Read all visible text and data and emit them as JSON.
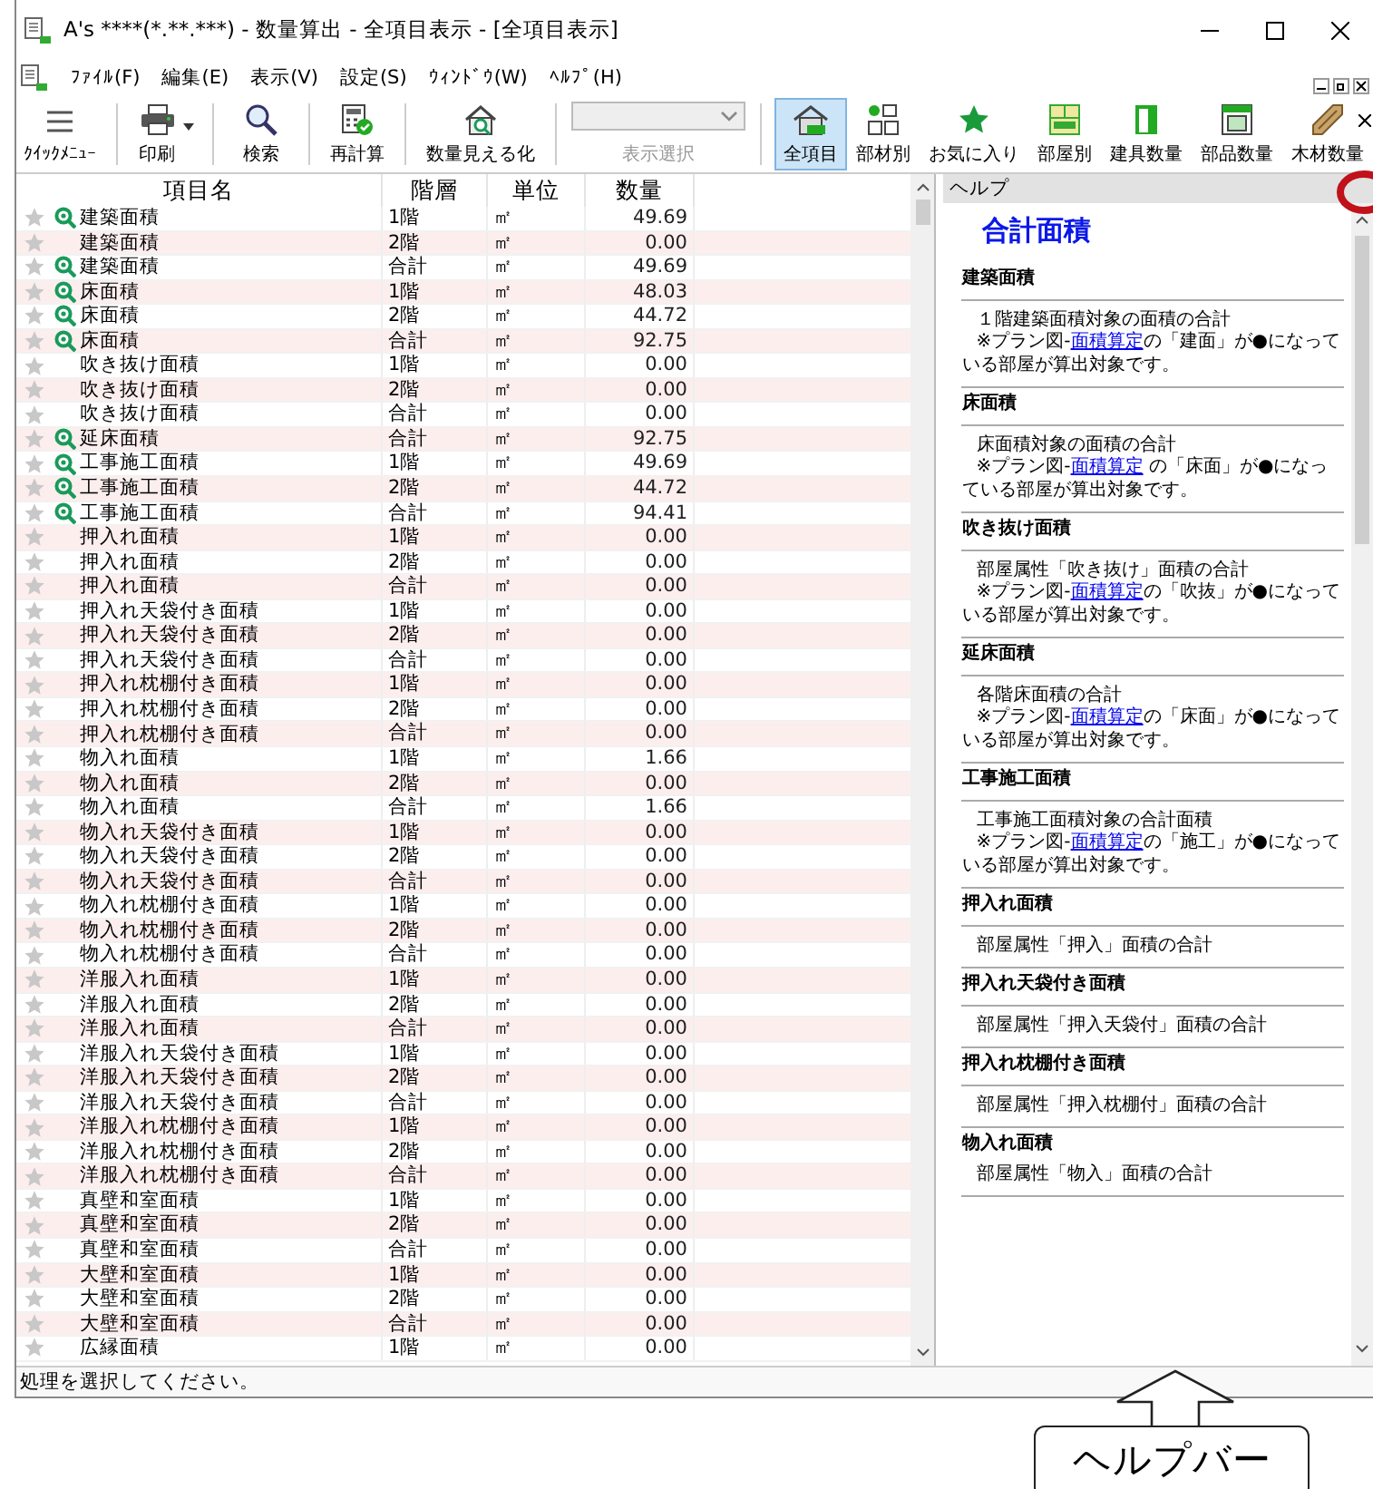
{
  "window": {
    "title": "A's ****(*.**.***) - 数量算出 - 全項目表示 - [全項目表示]"
  },
  "menu": [
    "ﾌｧｲﾙ(F)",
    "編集(E)",
    "表示(V)",
    "設定(S)",
    "ｳｨﾝﾄﾞｳ(W)",
    "ﾍﾙﾌﾟ(H)"
  ],
  "toolbar": {
    "tools": [
      {
        "label": "ｸｲｯｸﾒﾆｭｰ",
        "dropdown": false
      },
      {
        "label": "印刷",
        "dropdown": true
      },
      {
        "label": "検索",
        "dropdown": false
      },
      {
        "label": "再計算",
        "dropdown": false
      },
      {
        "label": "数量見える化",
        "dropdown": false
      }
    ],
    "view_select": {
      "label": "表示選択",
      "disabled": true
    },
    "views": [
      {
        "label": "全項目",
        "selected": true
      },
      {
        "label": "部材別",
        "selected": false
      },
      {
        "label": "お気に入り",
        "selected": false
      },
      {
        "label": "部屋別",
        "selected": false
      },
      {
        "label": "建具数量",
        "selected": false
      },
      {
        "label": "部品数量",
        "selected": false
      },
      {
        "label": "木材数量",
        "selected": false
      }
    ]
  },
  "table": {
    "columns": [
      "項目名",
      "階層",
      "単位",
      "数量"
    ],
    "rows": [
      {
        "favorite": false,
        "search": true,
        "name": "建築面積",
        "floor": "1階",
        "unit": "㎡",
        "qty": "49.69"
      },
      {
        "favorite": false,
        "search": false,
        "name": "建築面積",
        "floor": "2階",
        "unit": "㎡",
        "qty": "0.00"
      },
      {
        "favorite": false,
        "search": true,
        "name": "建築面積",
        "floor": "合計",
        "unit": "㎡",
        "qty": "49.69"
      },
      {
        "favorite": false,
        "search": true,
        "name": "床面積",
        "floor": "1階",
        "unit": "㎡",
        "qty": "48.03"
      },
      {
        "favorite": false,
        "search": true,
        "name": "床面積",
        "floor": "2階",
        "unit": "㎡",
        "qty": "44.72"
      },
      {
        "favorite": false,
        "search": true,
        "name": "床面積",
        "floor": "合計",
        "unit": "㎡",
        "qty": "92.75"
      },
      {
        "favorite": false,
        "search": false,
        "name": "吹き抜け面積",
        "floor": "1階",
        "unit": "㎡",
        "qty": "0.00"
      },
      {
        "favorite": false,
        "search": false,
        "name": "吹き抜け面積",
        "floor": "2階",
        "unit": "㎡",
        "qty": "0.00"
      },
      {
        "favorite": false,
        "search": false,
        "name": "吹き抜け面積",
        "floor": "合計",
        "unit": "㎡",
        "qty": "0.00"
      },
      {
        "favorite": false,
        "search": true,
        "name": "延床面積",
        "floor": "合計",
        "unit": "㎡",
        "qty": "92.75"
      },
      {
        "favorite": false,
        "search": true,
        "name": "工事施工面積",
        "floor": "1階",
        "unit": "㎡",
        "qty": "49.69"
      },
      {
        "favorite": false,
        "search": true,
        "name": "工事施工面積",
        "floor": "2階",
        "unit": "㎡",
        "qty": "44.72"
      },
      {
        "favorite": false,
        "search": true,
        "name": "工事施工面積",
        "floor": "合計",
        "unit": "㎡",
        "qty": "94.41"
      },
      {
        "favorite": false,
        "search": false,
        "name": "押入れ面積",
        "floor": "1階",
        "unit": "㎡",
        "qty": "0.00"
      },
      {
        "favorite": false,
        "search": false,
        "name": "押入れ面積",
        "floor": "2階",
        "unit": "㎡",
        "qty": "0.00"
      },
      {
        "favorite": false,
        "search": false,
        "name": "押入れ面積",
        "floor": "合計",
        "unit": "㎡",
        "qty": "0.00"
      },
      {
        "favorite": false,
        "search": false,
        "name": "押入れ天袋付き面積",
        "floor": "1階",
        "unit": "㎡",
        "qty": "0.00"
      },
      {
        "favorite": false,
        "search": false,
        "name": "押入れ天袋付き面積",
        "floor": "2階",
        "unit": "㎡",
        "qty": "0.00"
      },
      {
        "favorite": false,
        "search": false,
        "name": "押入れ天袋付き面積",
        "floor": "合計",
        "unit": "㎡",
        "qty": "0.00"
      },
      {
        "favorite": false,
        "search": false,
        "name": "押入れ枕棚付き面積",
        "floor": "1階",
        "unit": "㎡",
        "qty": "0.00"
      },
      {
        "favorite": false,
        "search": false,
        "name": "押入れ枕棚付き面積",
        "floor": "2階",
        "unit": "㎡",
        "qty": "0.00"
      },
      {
        "favorite": false,
        "search": false,
        "name": "押入れ枕棚付き面積",
        "floor": "合計",
        "unit": "㎡",
        "qty": "0.00"
      },
      {
        "favorite": false,
        "search": false,
        "name": "物入れ面積",
        "floor": "1階",
        "unit": "㎡",
        "qty": "1.66"
      },
      {
        "favorite": false,
        "search": false,
        "name": "物入れ面積",
        "floor": "2階",
        "unit": "㎡",
        "qty": "0.00"
      },
      {
        "favorite": false,
        "search": false,
        "name": "物入れ面積",
        "floor": "合計",
        "unit": "㎡",
        "qty": "1.66"
      },
      {
        "favorite": false,
        "search": false,
        "name": "物入れ天袋付き面積",
        "floor": "1階",
        "unit": "㎡",
        "qty": "0.00"
      },
      {
        "favorite": false,
        "search": false,
        "name": "物入れ天袋付き面積",
        "floor": "2階",
        "unit": "㎡",
        "qty": "0.00"
      },
      {
        "favorite": false,
        "search": false,
        "name": "物入れ天袋付き面積",
        "floor": "合計",
        "unit": "㎡",
        "qty": "0.00"
      },
      {
        "favorite": false,
        "search": false,
        "name": "物入れ枕棚付き面積",
        "floor": "1階",
        "unit": "㎡",
        "qty": "0.00"
      },
      {
        "favorite": false,
        "search": false,
        "name": "物入れ枕棚付き面積",
        "floor": "2階",
        "unit": "㎡",
        "qty": "0.00"
      },
      {
        "favorite": false,
        "search": false,
        "name": "物入れ枕棚付き面積",
        "floor": "合計",
        "unit": "㎡",
        "qty": "0.00"
      },
      {
        "favorite": false,
        "search": false,
        "name": "洋服入れ面積",
        "floor": "1階",
        "unit": "㎡",
        "qty": "0.00"
      },
      {
        "favorite": false,
        "search": false,
        "name": "洋服入れ面積",
        "floor": "2階",
        "unit": "㎡",
        "qty": "0.00"
      },
      {
        "favorite": false,
        "search": false,
        "name": "洋服入れ面積",
        "floor": "合計",
        "unit": "㎡",
        "qty": "0.00"
      },
      {
        "favorite": false,
        "search": false,
        "name": "洋服入れ天袋付き面積",
        "floor": "1階",
        "unit": "㎡",
        "qty": "0.00"
      },
      {
        "favorite": false,
        "search": false,
        "name": "洋服入れ天袋付き面積",
        "floor": "2階",
        "unit": "㎡",
        "qty": "0.00"
      },
      {
        "favorite": false,
        "search": false,
        "name": "洋服入れ天袋付き面積",
        "floor": "合計",
        "unit": "㎡",
        "qty": "0.00"
      },
      {
        "favorite": false,
        "search": false,
        "name": "洋服入れ枕棚付き面積",
        "floor": "1階",
        "unit": "㎡",
        "qty": "0.00"
      },
      {
        "favorite": false,
        "search": false,
        "name": "洋服入れ枕棚付き面積",
        "floor": "2階",
        "unit": "㎡",
        "qty": "0.00"
      },
      {
        "favorite": false,
        "search": false,
        "name": "洋服入れ枕棚付き面積",
        "floor": "合計",
        "unit": "㎡",
        "qty": "0.00"
      },
      {
        "favorite": false,
        "search": false,
        "name": "真壁和室面積",
        "floor": "1階",
        "unit": "㎡",
        "qty": "0.00"
      },
      {
        "favorite": false,
        "search": false,
        "name": "真壁和室面積",
        "floor": "2階",
        "unit": "㎡",
        "qty": "0.00"
      },
      {
        "favorite": false,
        "search": false,
        "name": "真壁和室面積",
        "floor": "合計",
        "unit": "㎡",
        "qty": "0.00"
      },
      {
        "favorite": false,
        "search": false,
        "name": "大壁和室面積",
        "floor": "1階",
        "unit": "㎡",
        "qty": "0.00"
      },
      {
        "favorite": false,
        "search": false,
        "name": "大壁和室面積",
        "floor": "2階",
        "unit": "㎡",
        "qty": "0.00"
      },
      {
        "favorite": false,
        "search": false,
        "name": "大壁和室面積",
        "floor": "合計",
        "unit": "㎡",
        "qty": "0.00"
      },
      {
        "favorite": false,
        "search": false,
        "name": "広縁面積",
        "floor": "1階",
        "unit": "㎡",
        "qty": "0.00"
      }
    ]
  },
  "help": {
    "header": "ヘルプ",
    "title": "合計面積",
    "sections": [
      {
        "heading": "建築面積",
        "divided": true,
        "summary": "１階建築面積対象の面積の合計",
        "note": {
          "before": "※プラン図-",
          "link": "面積算定",
          "after": "の「建面」が●になっている部屋が算出対象です。"
        }
      },
      {
        "heading": "床面積",
        "divided": true,
        "summary": "床面積対象の面積の合計",
        "note": {
          "before": "※プラン図-",
          "link": "面積算定",
          "after": " の「床面」が●になっている部屋が算出対象です。"
        }
      },
      {
        "heading": "吹き抜け面積",
        "divided": true,
        "summary": "部屋属性「吹き抜け」面積の合計",
        "note": {
          "before": "※プラン図-",
          "link": "面積算定",
          "after": "の「吹抜」が●になっている部屋が算出対象です。"
        }
      },
      {
        "heading": "延床面積",
        "divided": true,
        "summary": "各階床面積の合計",
        "note": {
          "before": "※プラン図-",
          "link": "面積算定",
          "after": "の「床面」が●になっている部屋が算出対象です。"
        }
      },
      {
        "heading": "工事施工面積",
        "divided": true,
        "summary": "工事施工面積対象の合計面積",
        "note": {
          "before": "※プラン図-",
          "link": "面積算定",
          "after": "の「施工」が●になっている部屋が算出対象です。"
        }
      },
      {
        "heading": "押入れ面積",
        "divided": true,
        "summary": "部屋属性「押入」面積の合計"
      },
      {
        "heading": "押入れ天袋付き面積",
        "divided": true,
        "summary": "部屋属性「押入天袋付」面積の合計"
      },
      {
        "heading": "押入れ枕棚付き面積",
        "divided": true,
        "summary": "部屋属性「押入枕棚付」面積の合計"
      },
      {
        "heading": "物入れ面積",
        "divided": false,
        "summary": "部屋属性「物入」面積の合計"
      }
    ]
  },
  "status_bar": "処理を選択してください。",
  "callout": {
    "label": "ヘルプバー"
  }
}
